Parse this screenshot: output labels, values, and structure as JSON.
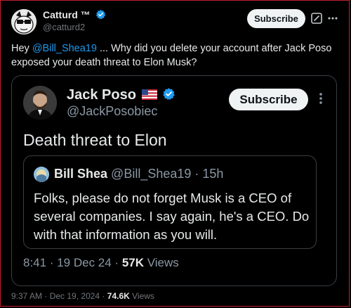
{
  "post": {
    "author_name": "Catturd ™",
    "author_handle": "@catturd2",
    "subscribe_label": "Subscribe",
    "more_icon": "more-horizontal-icon",
    "grok_icon": "grok-icon",
    "text_prefix": "Hey ",
    "mention": "@Bill_Shea19",
    "text_suffix": " ... Why did you delete your account after Jack Poso exposed your death threat to Elon Musk?",
    "time": "9:37 AM",
    "date": "Dec 19, 2024",
    "views_count": "74.6K",
    "views_label": "Views",
    "sep": " · "
  },
  "quoted": {
    "author_name": "Jack Poso",
    "flag": "🇺🇸",
    "author_handle": "@JackPosobiec",
    "subscribe_label": "Subscribe",
    "text": "Death threat to Elon",
    "time": "8:41",
    "date": "19 Dec 24",
    "views_count": "57K",
    "views_label": "Views",
    "sep": " · "
  },
  "nested_quote": {
    "author_name": "Bill Shea",
    "author_handle": "@Bill_Shea19",
    "age": "15h",
    "sep": " · ",
    "text": "Folks, please do not forget Musk is a CEO of several companies. I say again, he's a CEO. Do with that information as you will."
  },
  "colors": {
    "background": "#000000",
    "accent": "#1d9bf0",
    "text": "#e7e9ea",
    "muted": "#71767b",
    "verified": "#1d9bf0"
  }
}
